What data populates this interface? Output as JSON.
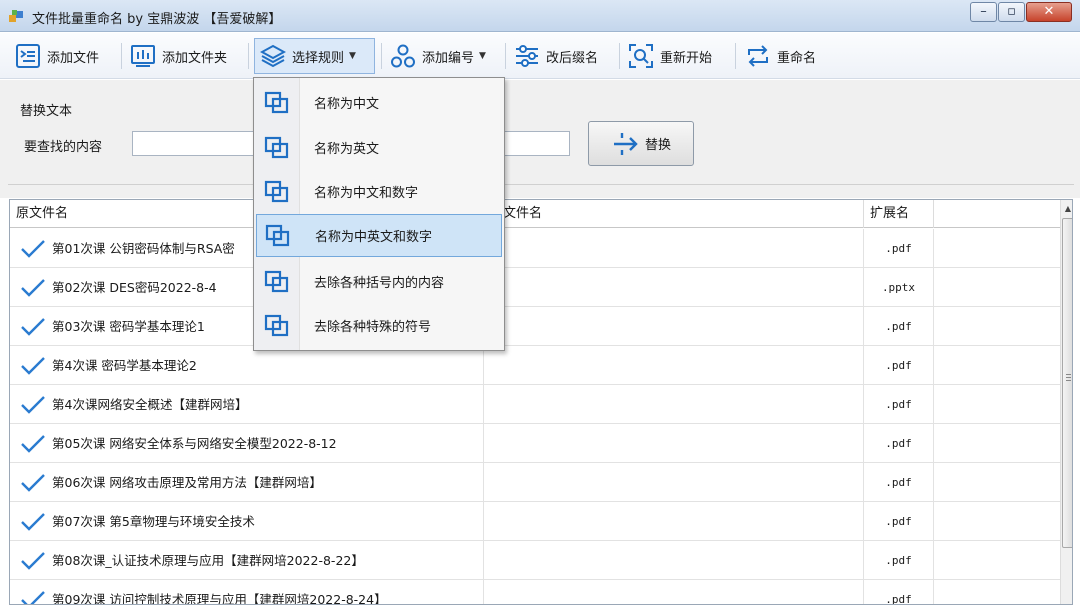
{
  "window": {
    "title": "文件批量重命名 by 宝鼎波波 【吾爱破解】",
    "buttons": [
      "minimize-icon",
      "maximize-icon",
      "close-icon"
    ]
  },
  "toolbar": {
    "add_file": "添加文件",
    "add_folder": "添加文件夹",
    "select_rule": "选择规则",
    "add_number": "添加编号",
    "change_ext": "改后缀名",
    "restart": "重新开始",
    "rename": "重命名"
  },
  "replace": {
    "group_title": "替换文本",
    "find_label": "要查找的内容",
    "find_value": "",
    "replace_value": "",
    "button": "替换"
  },
  "menu": {
    "items": [
      {
        "label": "名称为中文",
        "highlighted": false
      },
      {
        "label": "名称为英文",
        "highlighted": false
      },
      {
        "label": "名称为中文和数字",
        "highlighted": false
      },
      {
        "label": "名称为中英文和数字",
        "highlighted": true
      },
      {
        "label": "去除各种括号内的内容",
        "highlighted": false
      },
      {
        "label": "去除各种特殊的符号",
        "highlighted": false
      }
    ]
  },
  "grid": {
    "columns": [
      "原文件名",
      "新文件名",
      "扩展名"
    ],
    "rows": [
      {
        "name": "第01次课 公钥密码体制与RSA密",
        "new_name": "",
        "ext": ".pdf"
      },
      {
        "name": "第02次课 DES密码2022-8-4",
        "new_name": "",
        "ext": ".pptx"
      },
      {
        "name": "第03次课 密码学基本理论1",
        "new_name": "",
        "ext": ".pdf"
      },
      {
        "name": "第4次课 密码学基本理论2",
        "new_name": "",
        "ext": ".pdf"
      },
      {
        "name": "第4次课网络安全概述【建群网培】",
        "new_name": "",
        "ext": ".pdf"
      },
      {
        "name": "第05次课 网络安全体系与网络安全模型2022-8-12",
        "new_name": "",
        "ext": ".pdf"
      },
      {
        "name": "第06次课 网络攻击原理及常用方法【建群网培】",
        "new_name": "",
        "ext": ".pdf"
      },
      {
        "name": "第07次课 第5章物理与环境安全技术",
        "new_name": "",
        "ext": ".pdf"
      },
      {
        "name": "第08次课_认证技术原理与应用【建群网培2022-8-22】",
        "new_name": "",
        "ext": ".pdf"
      },
      {
        "name": "第09次课 访问控制技术原理与应用【建群网培2022-8-24】",
        "new_name": "",
        "ext": ".pdf"
      }
    ]
  },
  "colors": {
    "accent": "#1f6fc4",
    "check": "#2a7bd0",
    "menu_highlight": "#cfe4f7"
  }
}
